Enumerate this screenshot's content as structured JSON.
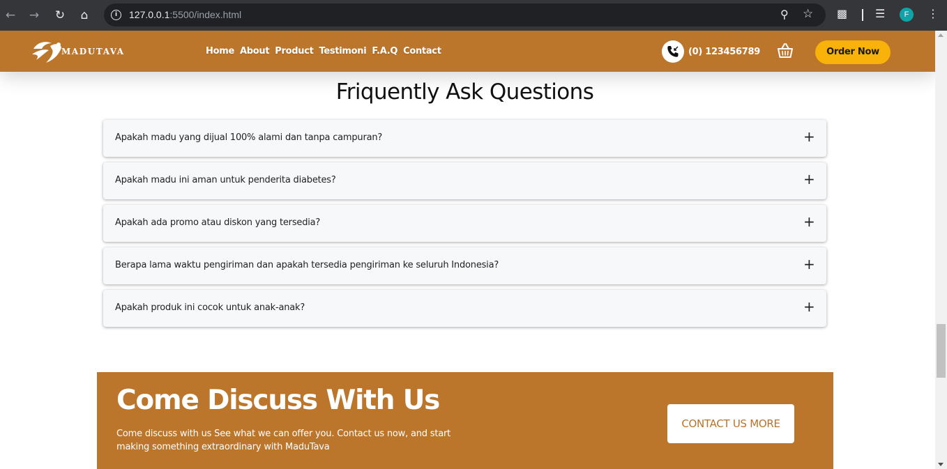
{
  "browser": {
    "url_host": "127.0.0.1",
    "url_rest": ":5500/index.html",
    "back_icon": "arrow-left-icon",
    "forward_icon": "arrow-right-icon",
    "reload_icon": "reload-icon",
    "home_icon": "home-icon",
    "profile_initial": "F",
    "profile_color": "#12a3a8"
  },
  "header": {
    "brand": "MADUTAVA",
    "nav": [
      "Home",
      "About",
      "Product",
      "Testimoni",
      "F.A.Q",
      "Contact"
    ],
    "phone": "(0) 123456789",
    "order_label": "Order Now",
    "accent_color": "#bb762c",
    "button_color": "#f9b209"
  },
  "faq": {
    "title": "Friquently Ask Questions",
    "items": [
      {
        "question": "Apakah madu yang dijual 100% alami dan tanpa campuran?",
        "toggle": "+"
      },
      {
        "question": "Apakah madu ini aman untuk penderita diabetes?",
        "toggle": "+"
      },
      {
        "question": "Apakah ada promo atau diskon yang tersedia?",
        "toggle": "+"
      },
      {
        "question": "Berapa lama waktu pengiriman dan apakah tersedia pengiriman ke seluruh Indonesia?",
        "toggle": "+"
      },
      {
        "question": "Apakah produk ini cocok untuk anak-anak?",
        "toggle": "+"
      }
    ]
  },
  "cta": {
    "title": "Come Discuss With Us",
    "text": "Come discuss with us See what we can offer you. Contact us now, and start making something extraordinary with MaduTava",
    "button_label": "CONTACT US MORE"
  }
}
